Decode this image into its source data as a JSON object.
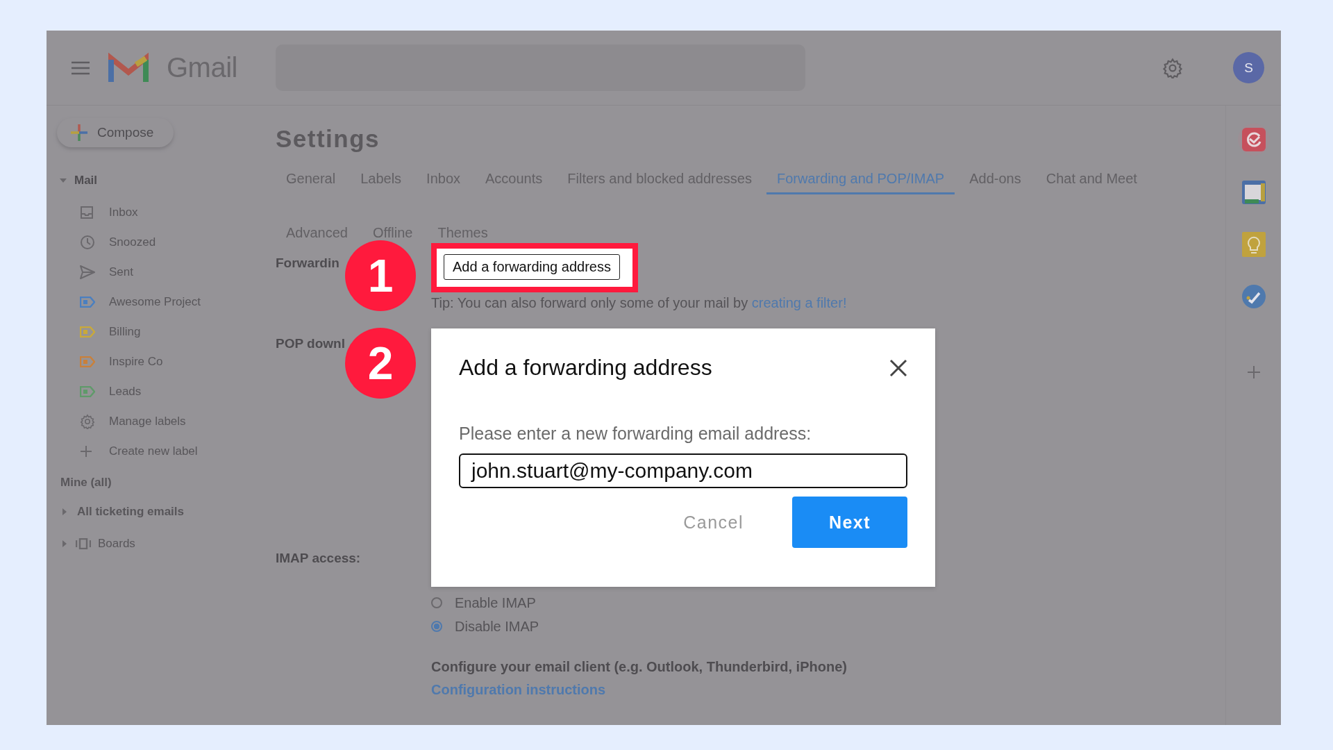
{
  "header": {
    "app_name": "Gmail",
    "avatar_initial": "S"
  },
  "compose": "Compose",
  "sidebar": {
    "section": "Mail",
    "expanded": true,
    "items": [
      {
        "kind": "inbox",
        "label": "Inbox"
      },
      {
        "kind": "clock",
        "label": "Snoozed"
      },
      {
        "kind": "send",
        "label": "Sent"
      },
      {
        "kind": "label",
        "label": "Awesome Project",
        "color": "#4a7fc0"
      },
      {
        "kind": "label",
        "label": "Billing",
        "color": "#c9a93a"
      },
      {
        "kind": "label",
        "label": "Inspire Co",
        "color": "#c9803a"
      },
      {
        "kind": "label",
        "label": "Leads",
        "color": "#5f9a6a"
      },
      {
        "kind": "gear",
        "label": "Manage labels"
      },
      {
        "kind": "plus",
        "label": "Create new label"
      }
    ],
    "mine": "Mine (all)",
    "groups": [
      {
        "kind": "plain",
        "label": "All ticketing emails",
        "expanded": false
      },
      {
        "kind": "boards",
        "label": "Boards",
        "expanded": false
      }
    ]
  },
  "settings": {
    "title": "Settings",
    "tab_rows": [
      [
        {
          "label": "General",
          "selected": false
        },
        {
          "label": "Labels",
          "selected": false
        },
        {
          "label": "Inbox",
          "selected": false
        },
        {
          "label": "Accounts",
          "selected": false
        },
        {
          "label": "Filters and blocked addresses",
          "selected": false
        },
        {
          "label": "Forwarding and POP/IMAP",
          "selected": true
        },
        {
          "label": "Add-ons",
          "selected": false
        },
        {
          "label": "Chat and Meet",
          "selected": false
        }
      ],
      [
        {
          "label": "Advanced",
          "selected": false
        },
        {
          "label": "Offline",
          "selected": false
        },
        {
          "label": "Themes",
          "selected": false
        }
      ]
    ],
    "forwarding_label": "Forwardin",
    "forwarding_button": "Add a forwarding address",
    "tip": "Tip: You can also forward only some of your mail by",
    "tip_link": "creating a filter!",
    "pop_label": "POP downl",
    "imap_label": "IMAP access:",
    "imap_options": [
      {
        "label": "Enable IMAP",
        "selected": false
      },
      {
        "label": "Disable IMAP",
        "selected": true
      }
    ],
    "configure_text": "Configure your email client (e.g. Outlook, Thunderbird, iPhone)",
    "configure_link": "Configuration instructions"
  },
  "steps": [
    "1",
    "2"
  ],
  "dialog": {
    "title": "Add a forwarding address",
    "prompt": "Please enter a new forwarding email address:",
    "value": "john.stuart@my-company.com",
    "cancel": "Cancel",
    "next": "Next"
  }
}
